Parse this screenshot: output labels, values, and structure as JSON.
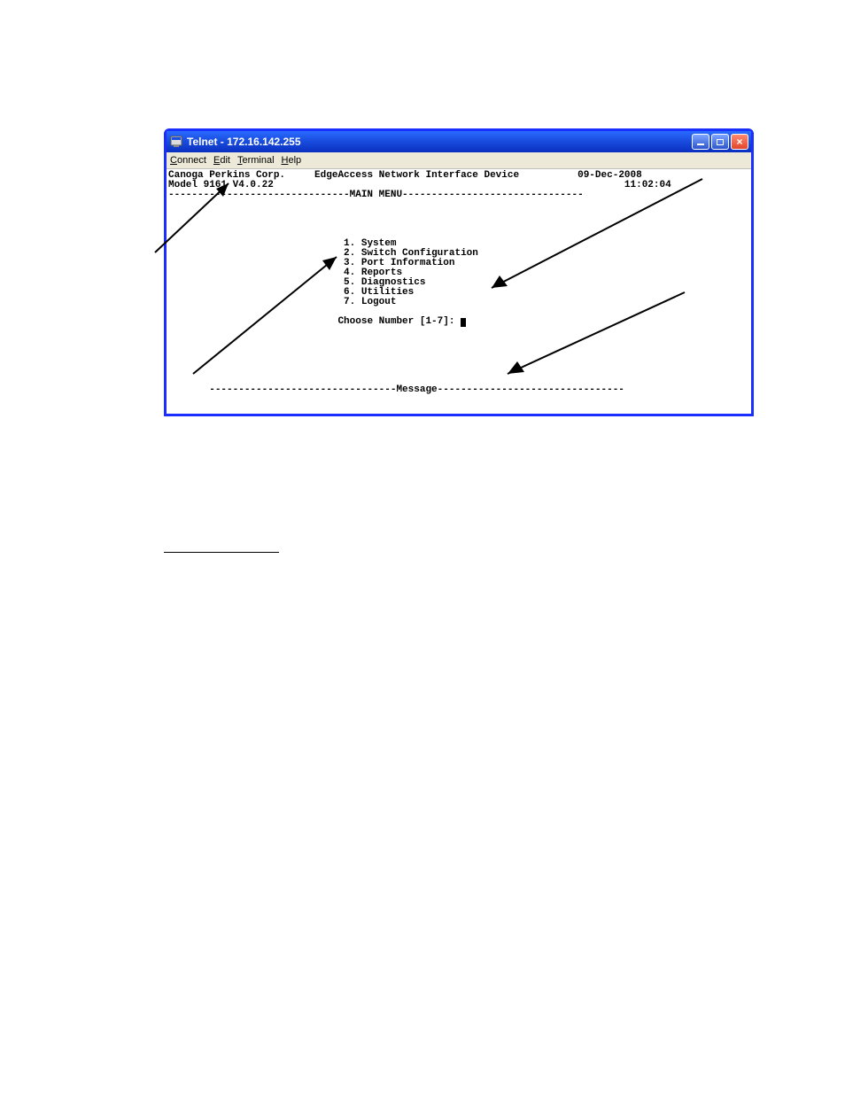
{
  "window": {
    "title": "Telnet - 172.16.142.255"
  },
  "menubar": {
    "items": [
      "Connect",
      "Edit",
      "Terminal",
      "Help"
    ]
  },
  "terminal": {
    "header": {
      "company": "Canoga Perkins Corp.",
      "device": "EdgeAccess Network Interface Device",
      "date": "09-Dec-2008",
      "model": "Model 9161 V4.0.22",
      "time": "11:02:04"
    },
    "divider_main": "-------------------------------MAIN MENU-------------------------------",
    "menu": {
      "items": [
        "1. System",
        "2. Switch Configuration",
        "3. Port Information",
        "4. Reports",
        "5. Diagnostics",
        "6. Utilities",
        "7. Logout"
      ],
      "prompt": "Choose Number [1-7]: "
    },
    "divider_message": "--------------------------------Message--------------------------------"
  }
}
